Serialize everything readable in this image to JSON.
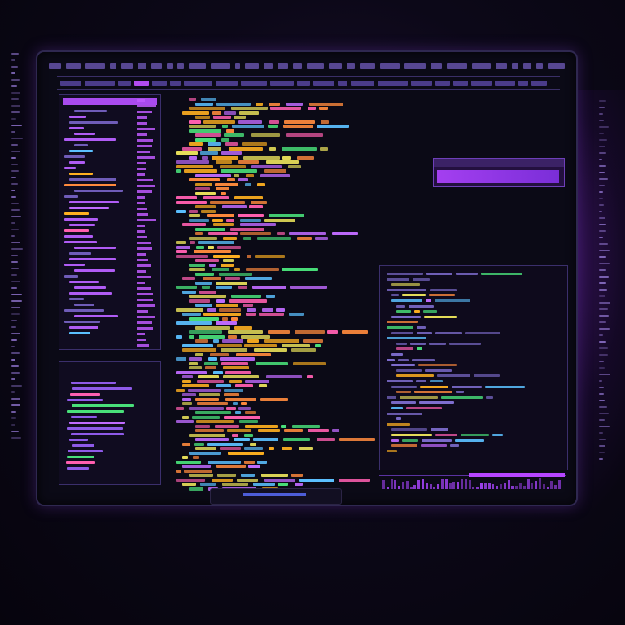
{
  "scene": {
    "description_free": true
  },
  "colors": {
    "accent": "#b24cf0",
    "code_colors": [
      "#ffb020",
      "#ff5fb0",
      "#49e07a",
      "#5bc0ff",
      "#c06bff",
      "#ff8a3d",
      "#e8e05a"
    ]
  },
  "icons": [
    "menu-icon",
    "close-icon"
  ]
}
